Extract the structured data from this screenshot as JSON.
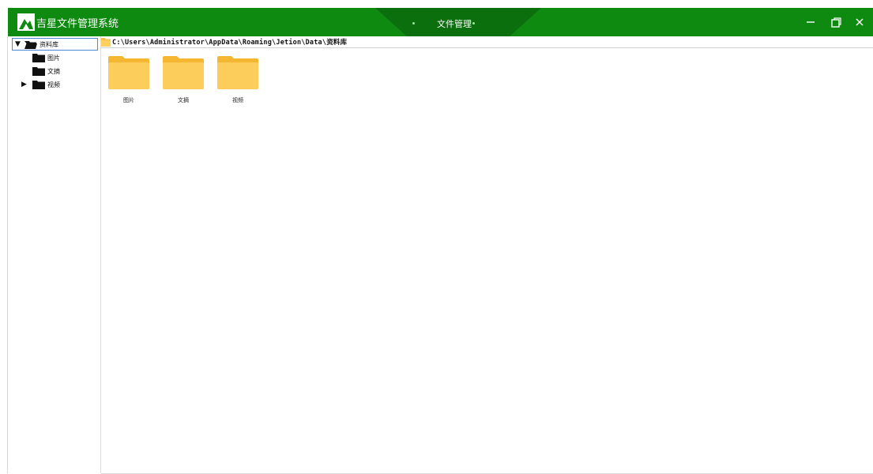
{
  "window": {
    "app_title": "吉星文件管理系统",
    "center_title": "文件管理",
    "accent_color": "#0e8a10",
    "controls": [
      "minimize-icon",
      "restore-icon",
      "close-icon"
    ]
  },
  "sidebar": {
    "root": {
      "label": "资料库",
      "expanded": true,
      "selected": true
    },
    "children": [
      {
        "label": "图片",
        "has_children": false
      },
      {
        "label": "文摘",
        "has_children": false
      },
      {
        "label": "视频",
        "has_children": true
      }
    ]
  },
  "pathbar": {
    "path": "C:\\Users\\Administrator\\AppData\\Roaming\\Jetion\\Data\\资料库"
  },
  "content": {
    "folders": [
      {
        "label": "图片"
      },
      {
        "label": "文摘"
      },
      {
        "label": "视频"
      }
    ]
  }
}
